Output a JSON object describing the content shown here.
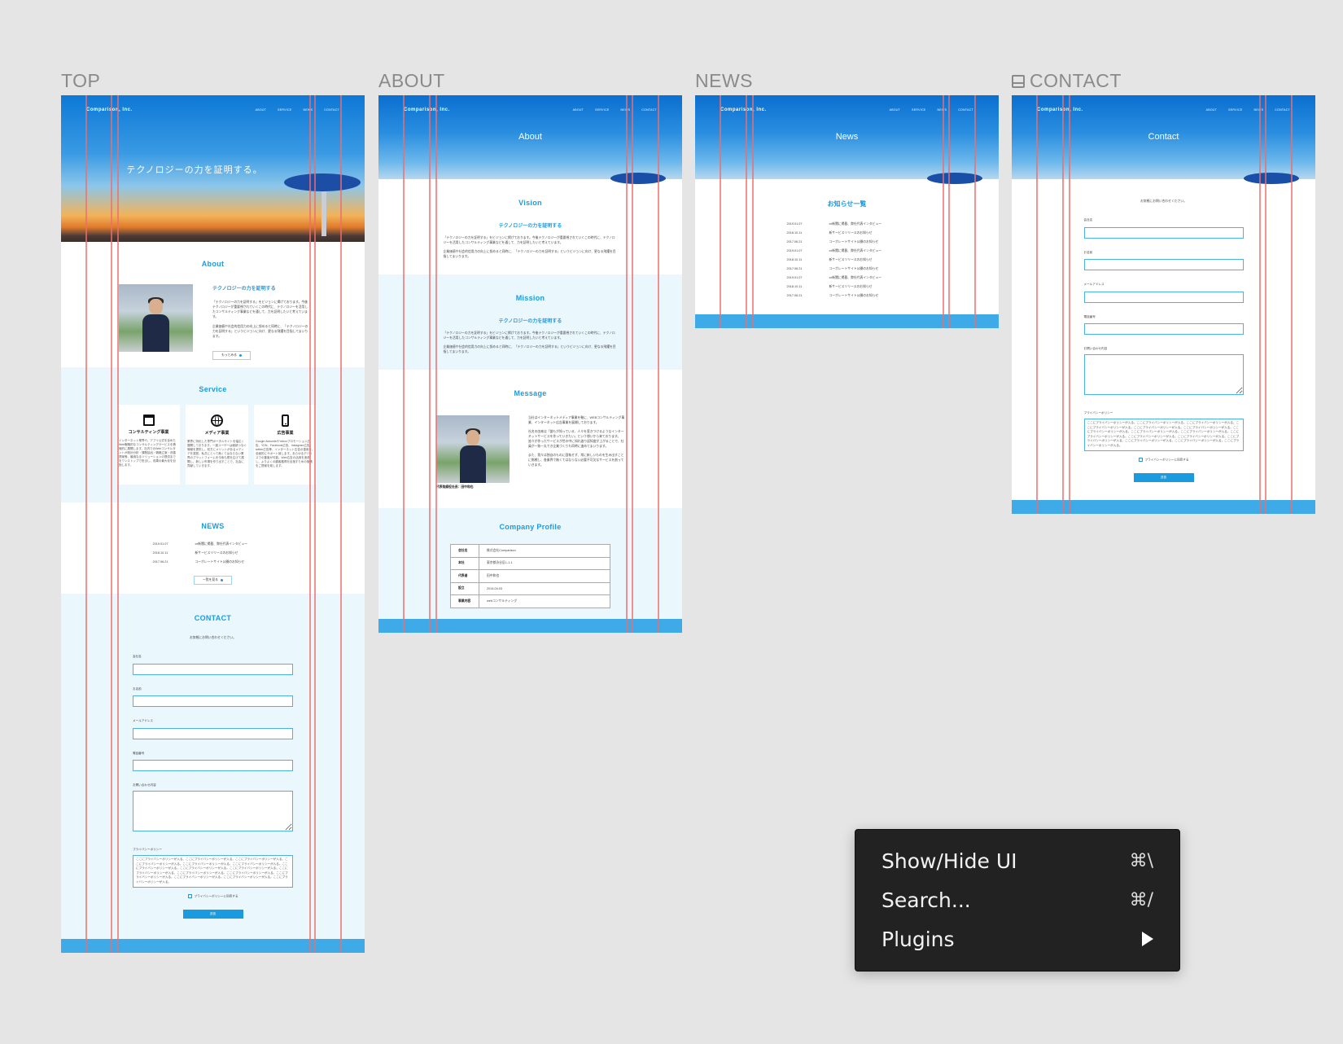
{
  "canvas": {
    "frames": [
      {
        "label": "TOP"
      },
      {
        "label": "ABOUT"
      },
      {
        "label": "NEWS"
      },
      {
        "label": "CONTACT",
        "icon": "frame-icon"
      }
    ]
  },
  "site": {
    "logo": "Comparison, Inc.",
    "nav": [
      "ABOUT",
      "SERVICE",
      "NEWS",
      "CONTACT"
    ],
    "accent": "#1a9be0",
    "footer_color": "#3faae8",
    "alt_bg": "#eaf7fd"
  },
  "top": {
    "hero_title": "テクノロジーの力を証明する。",
    "about": {
      "heading": "About",
      "subheading": "テクノロジーの力を証明する",
      "p1": "「テクノロジーの力を証明する」をビジョンに掲げております。今後テクノロジーが重要視されていくこの時代に、テクノロジーを活用したコンサルティング事業などを通して、力を証明したいと考えています。",
      "p2": "企業価値や社会的信用力の向上に努めると同時に、「テクノロジーの力を証明する」というビジョンに向け、更なる飛躍を目指してまいります。",
      "more_button": "もっとみる"
    },
    "service": {
      "heading": "Service",
      "cards": [
        {
          "icon": "browser-window-icon",
          "title": "コンサルティング事業",
          "text": "インターネット業界や、アプリ公式を含めたWeb戦略的なコンサルティングサービスを積極的に展開します。社内でのWebコンサルタントが統計分析・課題抽出・戦略立案・改善提案等、最適なるソリューションの提供までをワンストップで担当し、成果の最大化を目指します。"
        },
        {
          "icon": "globe-icon",
          "title": "メディア事業",
          "text": "業界に特化した専門ポータルサイトを幅広く展開しております。一度ユーザーは継続つなぐ情報を提供し、双方にメリットがあるメディアを運営。私共にとって無くてはならない業界のプラットフォームを今後も根を広げて展開し、新しい市場を作り出すことで、社会に貢献していきます。"
        },
        {
          "icon": "smartphone-icon",
          "title": "広告事業",
          "text": "Google AdwordsやYahooプロモーション広告、YDN、Facebook広告、Instagram広告、twitter広告等、インターネット広告の運用を、全面的にサポート致します。あらゆるデバイスでの集客が可能。Web広告の活用を追求し、よりよくの顧客獲得を目指すための施策をご提案を致します。"
        }
      ]
    },
    "news": {
      "heading": "NEWS",
      "items": [
        {
          "date": "2019.01.07",
          "title": "xx新聞に掲載、弊社代表インタビュー"
        },
        {
          "date": "2018.10.11",
          "title": "新サービスリリースのお知らせ"
        },
        {
          "date": "2017.06.21",
          "title": "コーポレートサイト公開のお知らせ"
        }
      ],
      "more_button": "一覧を見る"
    },
    "contact": {
      "heading": "CONTACT",
      "intro": "お気軽にお問い合わせください。"
    }
  },
  "about_page": {
    "hero_title": "About",
    "vision": {
      "heading": "Vision",
      "subheading": "テクノロジーの力を証明する",
      "p1": "「テクノロジーの力を証明する」をビジョンに掲げております。今後テクノロジーが重要視されていくこの時代に、テクノロジーを活用したコンサルティング事業などを通して、力を証明したいと考えています。",
      "p2": "企業価値や社会的信用力の向上に努めると同時に、「テクノロジーの力を証明する」というビジョンに向け、更なる飛躍を目指してまいります。"
    },
    "mission": {
      "heading": "Mission",
      "subheading": "テクノロジーの力を証明する",
      "p1": "「テクノロジーの力を証明する」をビジョンに掲げております。今後テクノロジーが重要視されていくこの時代に、テクノロジーを活用したコンサルティング事業などを通して、力を証明したいと考えています。",
      "p2": "企業価値や社会的信用力の向上に努めると同時に、「テクノロジーの力を証明する」というビジョンに向け、更なる飛躍を目指してまいります。"
    },
    "message": {
      "heading": "Message",
      "caption": "代表取締役社長：田中和也",
      "p1": "当社はインターネットメディア事業を軸に、WEBコンサルティング事業、インターネット広告事業を展開しております。",
      "p2": "社名の由来は「誰もが知っている、人々を惹きつけるようなインターネットサービスを作っていきたい」という想いから来ております。皆々が作ったサービスが世の中に知れ渡り認知度が上がることで、社員が一致一丸でき企業づくりも同時に進めてまいります。",
      "p3": "また、我々は独自のものに固執せず、常に新しいものを生み出すことに挑戦し、各業界で無くてはならない必要不可欠なサービスを創っていきます。"
    },
    "profile": {
      "heading": "Company Profile",
      "rows": [
        {
          "key": "会社名",
          "value": "株式会社Comparison"
        },
        {
          "key": "本社",
          "value": "東京都渋谷区1-1-1"
        },
        {
          "key": "代表者",
          "value": "田中和也"
        },
        {
          "key": "設立",
          "value": "2014.04.03"
        },
        {
          "key": "事業内容",
          "value": "webコンサルティング"
        }
      ]
    }
  },
  "news_page": {
    "hero_title": "News",
    "heading": "お知らせ一覧",
    "items": [
      {
        "date": "2019.01.07",
        "title": "xx新聞に掲載、弊社代表インタビュー"
      },
      {
        "date": "2018.10.11",
        "title": "新サービスリリースのお知らせ"
      },
      {
        "date": "2017.06.21",
        "title": "コーポレートサイト公開のお知らせ"
      },
      {
        "date": "2019.01.07",
        "title": "xx新聞に掲載、弊社代表インタビュー"
      },
      {
        "date": "2018.10.11",
        "title": "新サービスリリースのお知らせ"
      },
      {
        "date": "2017.06.21",
        "title": "コーポレートサイト公開のお知らせ"
      },
      {
        "date": "2019.01.07",
        "title": "xx新聞に掲載、弊社代表インタビュー"
      },
      {
        "date": "2018.10.11",
        "title": "新サービスリリースのお知らせ"
      },
      {
        "date": "2017.06.21",
        "title": "コーポレートサイト公開のお知らせ"
      }
    ]
  },
  "contact_form": {
    "hero_title": "Contact",
    "intro": "お気軽にお問い合わせください。",
    "fields": [
      {
        "label": "会社名",
        "value": "",
        "placeholder": ""
      },
      {
        "label": "お名前",
        "value": "",
        "placeholder": ""
      },
      {
        "label": "メールアドレス",
        "value": "",
        "placeholder": ""
      },
      {
        "label": "電話番号",
        "value": "",
        "placeholder": ""
      }
    ],
    "message_label": "お問い合わせ内容",
    "policy_label": "プライバシーポリシー",
    "policy_text": "ここにプライバシーポリシーが入る。ここにプライバシーポリシーが入る。ここにプライバシーポリシーが入る。ここにプライバシーポリシーが入る。ここにプライバシーポリシーが入る。ここにプライバシーポリシーが入る。ここにプライバシーポリシーが入る。ここにプライバシーポリシーが入る。ここにプライバシーポリシーが入る。ここにプライバシーポリシーが入る。ここにプライバシーポリシーが入る。ここにプライバシーポリシーが入る。ここにプライバシーポリシーが入る。ここにプライバシーポリシーが入る。ここにプライバシーポリシーが入る。ここにプライバシーポリシーが入る。",
    "agree_label": "プライバシーポリシーに同意する",
    "agree_checked": false,
    "submit_label": "送信"
  },
  "context_menu": {
    "items": [
      {
        "label": "Show/Hide UI",
        "shortcut": "⌘\\"
      },
      {
        "label": "Search...",
        "shortcut": "⌘/"
      },
      {
        "label": "Plugins",
        "submenu": true
      }
    ]
  }
}
